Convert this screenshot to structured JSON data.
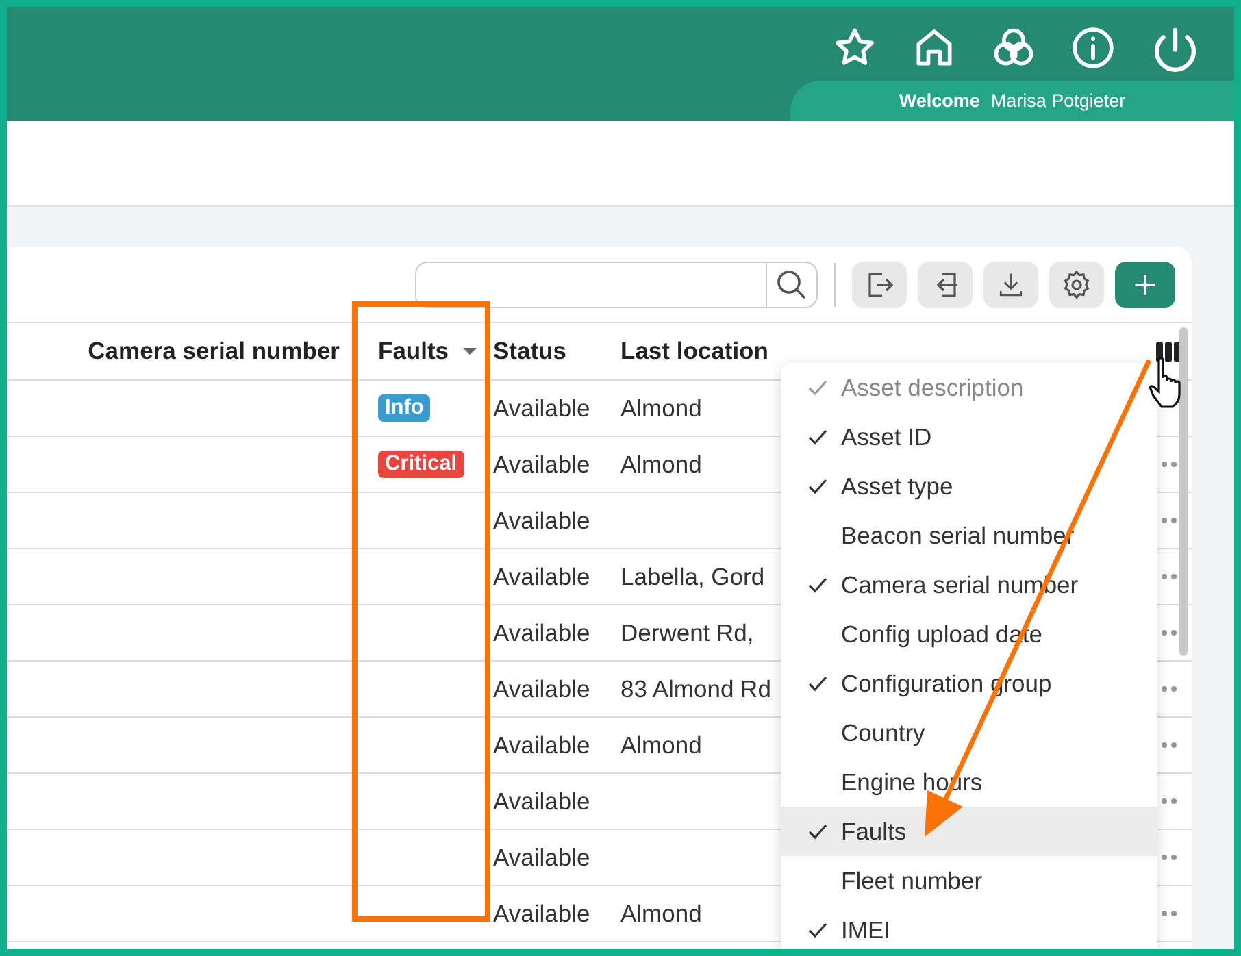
{
  "header": {
    "welcome_label": "Welcome",
    "user_name": "Marisa Potgieter"
  },
  "table": {
    "columns": [
      "Camera serial number",
      "Faults",
      "Status",
      "Last location"
    ],
    "rows": [
      {
        "fault": {
          "kind": "info",
          "label": "Info"
        },
        "status": "Available",
        "last_location": "Almond"
      },
      {
        "fault": {
          "kind": "critical",
          "label": "Critical"
        },
        "status": "Available",
        "last_location": "Almond"
      },
      {
        "status": "Available"
      },
      {
        "status": "Available",
        "last_location": "Labella, Gord"
      },
      {
        "status": "Available",
        "last_location": "Derwent Rd,"
      },
      {
        "status": "Available",
        "last_location": "83 Almond Rd"
      },
      {
        "status": "Available",
        "last_location": "Almond"
      },
      {
        "status": "Available"
      },
      {
        "status": "Available"
      },
      {
        "status": "Available",
        "last_location": "Almond"
      }
    ]
  },
  "column_menu": {
    "items": [
      {
        "label": "Asset description",
        "checked": true,
        "disabled": true,
        "selected": false
      },
      {
        "label": "Asset ID",
        "checked": true,
        "disabled": false,
        "selected": false
      },
      {
        "label": "Asset type",
        "checked": true,
        "disabled": false,
        "selected": false
      },
      {
        "label": "Beacon serial number",
        "checked": false,
        "disabled": false,
        "selected": false
      },
      {
        "label": "Camera serial number",
        "checked": true,
        "disabled": false,
        "selected": false
      },
      {
        "label": "Config upload date",
        "checked": false,
        "disabled": false,
        "selected": false
      },
      {
        "label": "Configuration group",
        "checked": true,
        "disabled": false,
        "selected": false
      },
      {
        "label": "Country",
        "checked": false,
        "disabled": false,
        "selected": false
      },
      {
        "label": "Engine hours",
        "checked": false,
        "disabled": false,
        "selected": false
      },
      {
        "label": "Faults",
        "checked": true,
        "disabled": false,
        "selected": true
      },
      {
        "label": "Fleet number",
        "checked": false,
        "disabled": false,
        "selected": false
      },
      {
        "label": "IMEI",
        "checked": true,
        "disabled": false,
        "selected": false
      }
    ]
  }
}
